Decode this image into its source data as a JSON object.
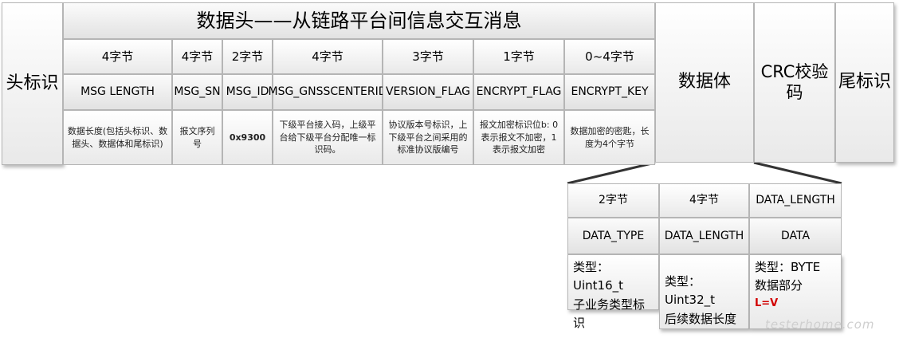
{
  "main_table": {
    "head_mark": "头标识",
    "header_title": "数据头——从链路平台间信息交互消息",
    "fields": [
      {
        "size": "4字节",
        "name": "MSG LENGTH",
        "desc": "数据长度(包括头标识、数据头、数据体和尾标识)"
      },
      {
        "size": "4字节",
        "name": "MSG_SN",
        "desc": "报文序列号"
      },
      {
        "size": "2字节",
        "name": "MSG_ID",
        "desc": "0x9300"
      },
      {
        "size": "4字节",
        "name": "MSG_GNSSCENTERID",
        "desc": "下级平台接入码，上级平台给下级平台分配唯一标识码。"
      },
      {
        "size": "3字节",
        "name": "VERSION_FLAG",
        "desc": "协议版本号标识，上下级平台之间采用的标准协议版编号"
      },
      {
        "size": "1字节",
        "name": "ENCRYPT_FLAG",
        "desc": "报文加密标识位b: 0表示报文不加密，1表示报文加密"
      },
      {
        "size": "0~4字节",
        "name": "ENCRYPT_KEY",
        "desc": "数据加密的密匙，长度为4个字节"
      }
    ],
    "data_body": "数据体",
    "crc": "CRC校验码",
    "tail_mark": "尾标识"
  },
  "sub_table": {
    "columns": [
      {
        "size": "2字节",
        "name": "DATA_TYPE",
        "type": "类型：Uint16_t",
        "desc": "子业务类型标识"
      },
      {
        "size": "4字节",
        "name": "DATA_LENGTH",
        "type": "类型：Uint32_t",
        "desc": "后续数据长度"
      },
      {
        "size": "DATA_LENGTH",
        "name": "DATA",
        "type": "类型：BYTE",
        "desc": "数据部分",
        "note": "L=V"
      }
    ]
  },
  "watermark": "testerhome.com",
  "colors": {
    "border": "#b5b5b5",
    "note_red": "#d20000",
    "connector": "#333333"
  }
}
